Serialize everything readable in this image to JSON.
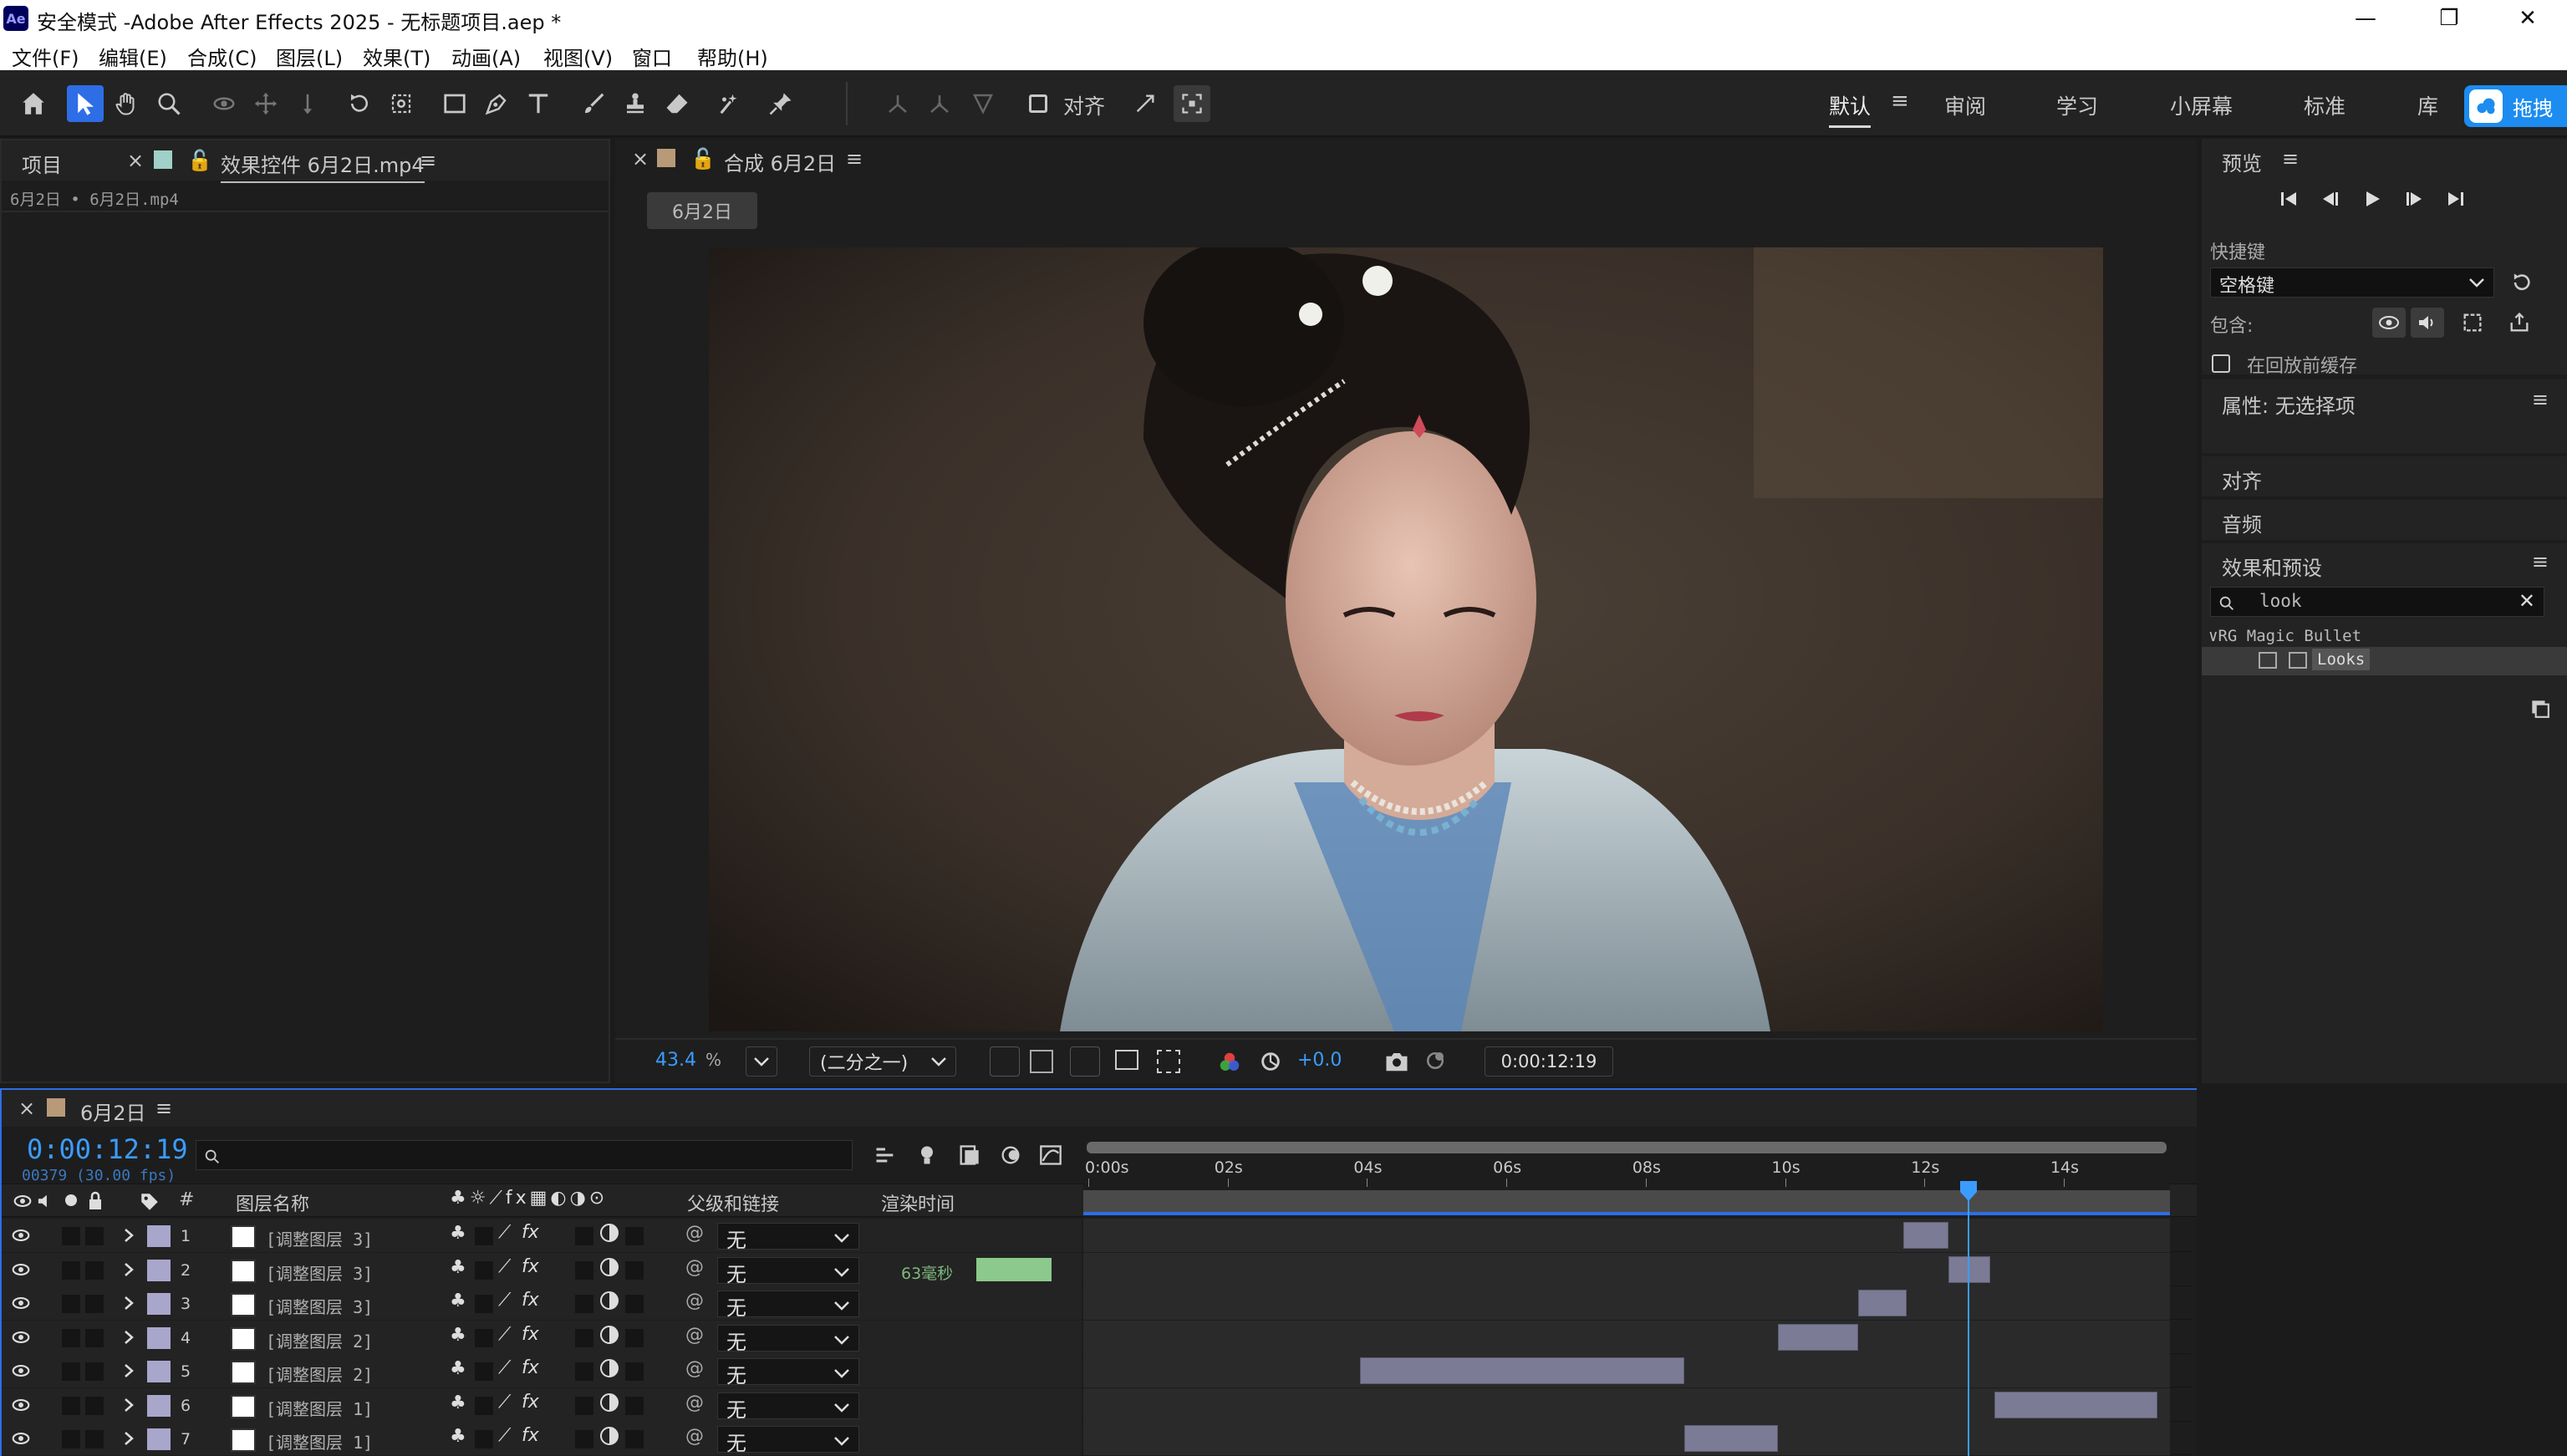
{
  "window": {
    "title": "安全模式 -Adobe After Effects 2025 - 无标题项目.aep *",
    "app_icon": "Ae",
    "controls": [
      "—",
      "❐",
      "✕"
    ]
  },
  "menu": [
    "文件(F)",
    "编辑(E)",
    "合成(C)",
    "图层(L)",
    "效果(T)",
    "动画(A)",
    "视图(V)",
    "窗口",
    "帮助(H)"
  ],
  "toolbar": {
    "align_label": "对齐",
    "workspaces": [
      "默认",
      "审阅",
      "学习",
      "小屏幕",
      "标准",
      "库"
    ],
    "active_workspace": "默认",
    "cloud_badge": "拖拽"
  },
  "project_panel": {
    "tab_project": "项目",
    "tab_effects": "效果控件 6月2日.mp4",
    "breadcrumb": "6月2日 • 6月2日.mp4"
  },
  "comp_panel": {
    "tab": "合成 6月2日",
    "comp_button": "6月2日",
    "zoom": "43.4",
    "zoom_unit": "%",
    "resolution": "(二分之一)",
    "exposure": "+0.0",
    "timecode": "0:00:12:19"
  },
  "preview_panel": {
    "title": "预览",
    "shortcut_label": "快捷键",
    "shortcut_value": "空格键",
    "include_label": "包含:",
    "cache_label": "在回放前缓存"
  },
  "right_panels": {
    "properties": "属性: 无选择项",
    "align": "对齐",
    "audio": "音频",
    "effects_presets": "效果和预设",
    "search_value": "look",
    "group": "RG Magic Bullet",
    "item": "Looks"
  },
  "timeline": {
    "tab": "6月2日",
    "timecode": "0:00:12:19",
    "frame_info": "00379 (30.00 fps)",
    "columns": {
      "hash": "#",
      "layer_name": "图层名称",
      "parent": "父级和链接",
      "render_time": "渲染时间"
    },
    "ruler": [
      "0:00s",
      "02s",
      "04s",
      "06s",
      "08s",
      "10s",
      "12s",
      "14s"
    ],
    "playhead_seconds": 12.63,
    "duration_seconds": 15.5,
    "layers": [
      {
        "num": "1",
        "name": "[调整图层 3]",
        "parent": "无",
        "render": "",
        "start": 11.7,
        "end": 12.35
      },
      {
        "num": "2",
        "name": "[调整图层 3]",
        "parent": "无",
        "render": "63毫秒",
        "start": 12.35,
        "end": 12.95
      },
      {
        "num": "3",
        "name": "[调整图层 3]",
        "parent": "无",
        "render": "",
        "start": 11.05,
        "end": 11.75
      },
      {
        "num": "4",
        "name": "[调整图层 2]",
        "parent": "无",
        "render": "",
        "start": 9.9,
        "end": 11.05
      },
      {
        "num": "5",
        "name": "[调整图层 2]",
        "parent": "无",
        "render": "",
        "start": 3.9,
        "end": 8.55
      },
      {
        "num": "6",
        "name": "[调整图层 1]",
        "parent": "无",
        "render": "",
        "start": 13.0,
        "end": 15.35
      },
      {
        "num": "7",
        "name": "[调整图层 1]",
        "parent": "无",
        "render": "",
        "start": 8.55,
        "end": 9.9
      }
    ]
  }
}
